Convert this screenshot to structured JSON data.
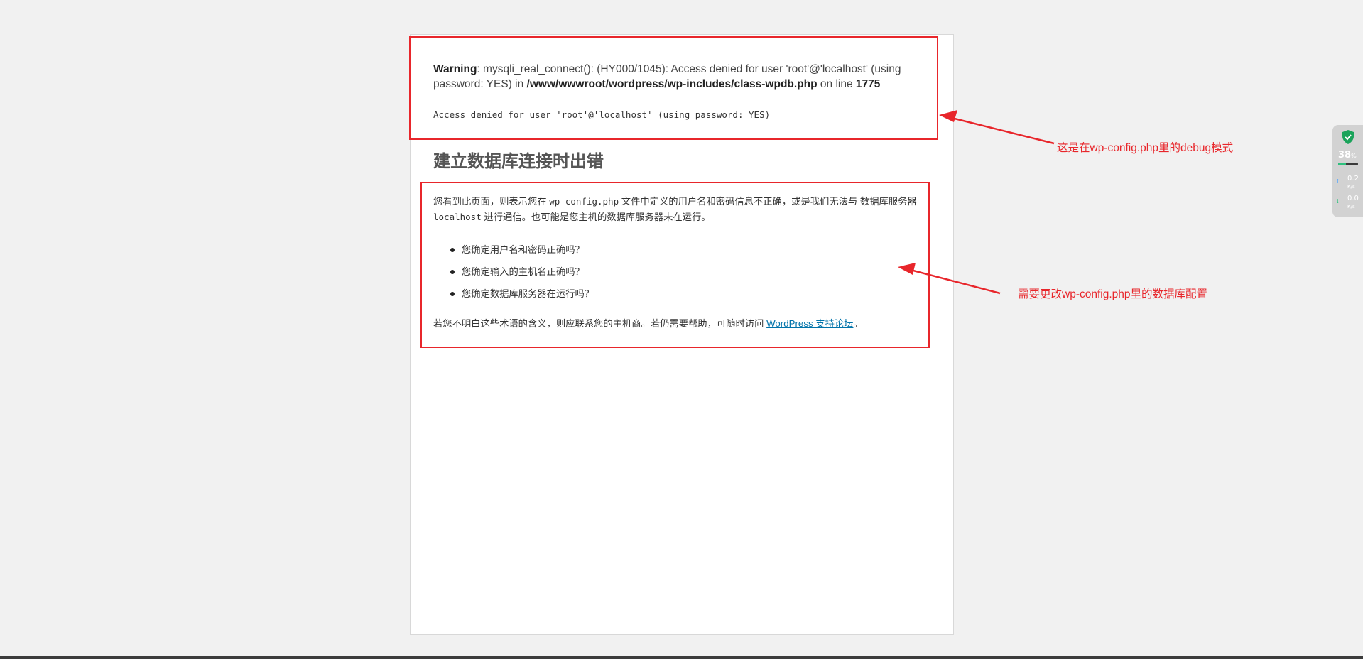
{
  "warning": {
    "label": "Warning",
    "text1": ": mysqli_real_connect(): (HY000/1045): Access denied for user 'root'@'localhost' (using password: YES) in ",
    "path": "/www/wwwroot/wordpress/wp-includes/class-wpdb.php",
    "text2": " on line ",
    "line": "1775"
  },
  "access_denied": "Access denied for user 'root'@'localhost' (using password: YES)",
  "heading": "建立数据库连接时出错",
  "body": {
    "part1": "您看到此页面，则表示您在 ",
    "file": "wp-config.php",
    "part2": " 文件中定义的用户名和密码信息不正确，或是我们无法与 数据库服务器 ",
    "host": "localhost",
    "part3": " 进行通信。也可能是您主机的数据库服务器未在运行。"
  },
  "list": [
    "您确定用户名和密码正确吗？",
    "您确定输入的主机名正确吗？",
    "您确定数据库服务器在运行吗？"
  ],
  "footer": {
    "text": "若您不明白这些术语的含义，则应联系您的主机商。若仍需要帮助，可随时访问 ",
    "link": "WordPress 支持论坛",
    "end": "。"
  },
  "annotations": {
    "debug": "这是在wp-config.php里的debug模式",
    "config": "需要更改wp-config.php里的数据库配置"
  },
  "widget": {
    "cpu_value": "38",
    "cpu_unit": "%",
    "cpu_fraction": 0.38,
    "upload_value": "0.2",
    "upload_unit": "K/s",
    "download_value": "0.0",
    "download_unit": "K/s",
    "shield_color": "#1aa35a"
  },
  "colors": {
    "annotation_red": "#e8262b",
    "link_blue": "#0073aa"
  }
}
